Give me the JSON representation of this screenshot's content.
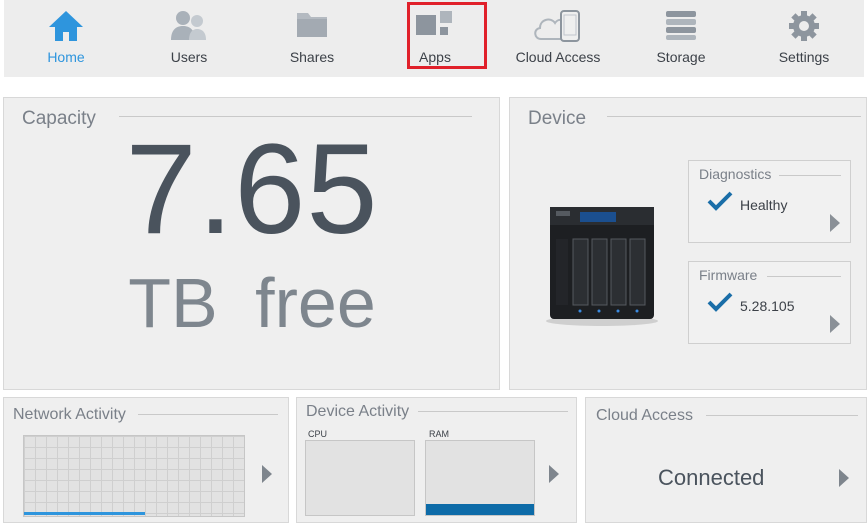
{
  "nav": {
    "items": [
      {
        "label": "Home",
        "icon": "home-icon",
        "active": true
      },
      {
        "label": "Users",
        "icon": "users-icon",
        "active": false
      },
      {
        "label": "Shares",
        "icon": "folder-icon",
        "active": false
      },
      {
        "label": "Apps",
        "icon": "apps-icon",
        "active": false
      },
      {
        "label": "Cloud Access",
        "icon": "cloud-device-icon",
        "active": false
      },
      {
        "label": "Storage",
        "icon": "storage-icon",
        "active": false
      },
      {
        "label": "Settings",
        "icon": "gear-icon",
        "active": false
      }
    ],
    "highlighted": "Apps",
    "active_color": "#2e95dd",
    "highlight_color": "#e0202a"
  },
  "capacity": {
    "title": "Capacity",
    "value": "7.65",
    "unit": "TB  free"
  },
  "device": {
    "title": "Device",
    "diagnostics": {
      "title": "Diagnostics",
      "value": "Healthy"
    },
    "firmware": {
      "title": "Firmware",
      "value": "5.28.105"
    }
  },
  "network_activity": {
    "title": "Network Activity",
    "progress_fraction": 0.55
  },
  "device_activity": {
    "title": "Device Activity",
    "cpu_label": "CPU",
    "ram_label": "RAM",
    "ram_fraction": 0.15,
    "ram_color": "#0d6ba8"
  },
  "cloud_access": {
    "title": "Cloud Access",
    "status": "Connected"
  }
}
